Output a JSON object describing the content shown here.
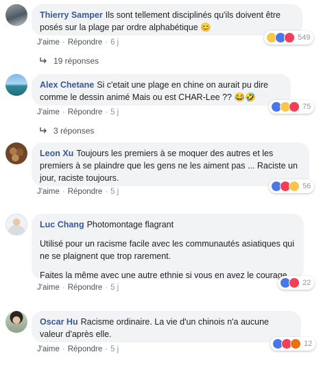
{
  "actions": {
    "like": "J'aime",
    "reply": "Répondre",
    "separator": "·"
  },
  "comments": [
    {
      "author": "Thierry Samper",
      "text": "Ils sont tellement disciplinés qu'ils doivent être posés sur la plage par ordre alphabétique 😊",
      "age": "6 j",
      "reaction_count": "549",
      "reactions": [
        "haha",
        "like",
        "love"
      ],
      "replies": "19 réponses"
    },
    {
      "author": "Alex Chetane",
      "text": "Si c'etait une plage en chine on aurait pu dire comme le dessin animé Mais ou est CHAR-Lee ?? 😂🤣",
      "age": "5 j",
      "reaction_count": "75",
      "reactions": [
        "like",
        "haha",
        "love"
      ],
      "replies": "3 réponses"
    },
    {
      "author": "Leon Xu",
      "text": "Toujours les premiers à se moquer des autres et les premiers à se plaindre que les gens ne les aiment pas ... Raciste un jour, raciste toujours.",
      "age": "5 j",
      "reaction_count": "56",
      "reactions": [
        "like",
        "love",
        "haha"
      ]
    },
    {
      "author": "Luc Chang",
      "text": "Photomontage flagrant",
      "para2": "Utilisé pour un racisme facile avec les communautés asiatiques qui ne se plaignent que trop rarement.",
      "para3": "Faites la même avec une autre ethnie si vous en avez le courage",
      "age": "5 j",
      "reaction_count": "22",
      "reactions": [
        "like",
        "love"
      ]
    },
    {
      "author": "Oscar Hu",
      "text": "Racisme ordinaire. La vie d'un chinois n'a aucune valeur d'après elle.",
      "age": "5 j",
      "reaction_count": "12",
      "reactions": [
        "like",
        "love",
        "angry"
      ]
    }
  ]
}
